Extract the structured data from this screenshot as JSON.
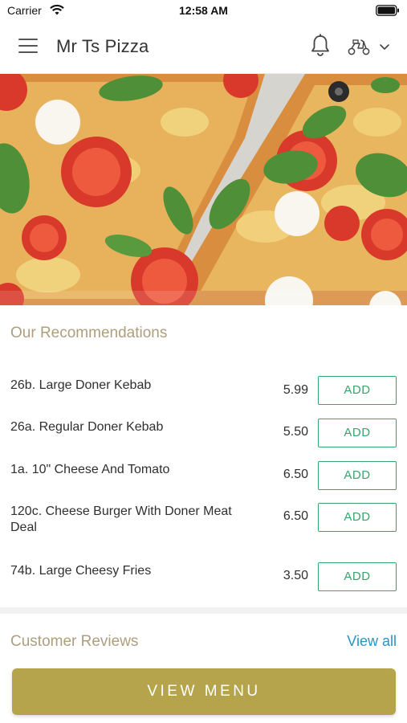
{
  "status_bar": {
    "carrier": "Carrier",
    "time": "12:58 AM"
  },
  "header": {
    "title": "Mr Ts Pizza",
    "icons": [
      "menu-icon",
      "bell-icon",
      "scooter-icon",
      "chevron-down-icon"
    ]
  },
  "hero": {
    "icon": "pizza-photo"
  },
  "recommendations": {
    "title": "Our Recommendations",
    "add_label": "ADD",
    "items": [
      {
        "name": "26b. Large Doner Kebab",
        "price": "5.99"
      },
      {
        "name": "26a. Regular Doner Kebab",
        "price": "5.50"
      },
      {
        "name": "1a. 10\" Cheese And Tomato",
        "price": "6.50"
      },
      {
        "name": "120c. Cheese Burger With Doner Meat Deal",
        "price": "6.50"
      },
      {
        "name": "74b. Large Cheesy Fries",
        "price": "3.50"
      }
    ]
  },
  "reviews": {
    "title": "Customer Reviews",
    "view_all": "View all"
  },
  "footer": {
    "view_menu": "VIEW MENU"
  },
  "colors": {
    "accent_gold": "#b5a44b",
    "section_title": "#ad9f7c",
    "add_green": "#3aa36a",
    "link_blue": "#2a93c5"
  }
}
